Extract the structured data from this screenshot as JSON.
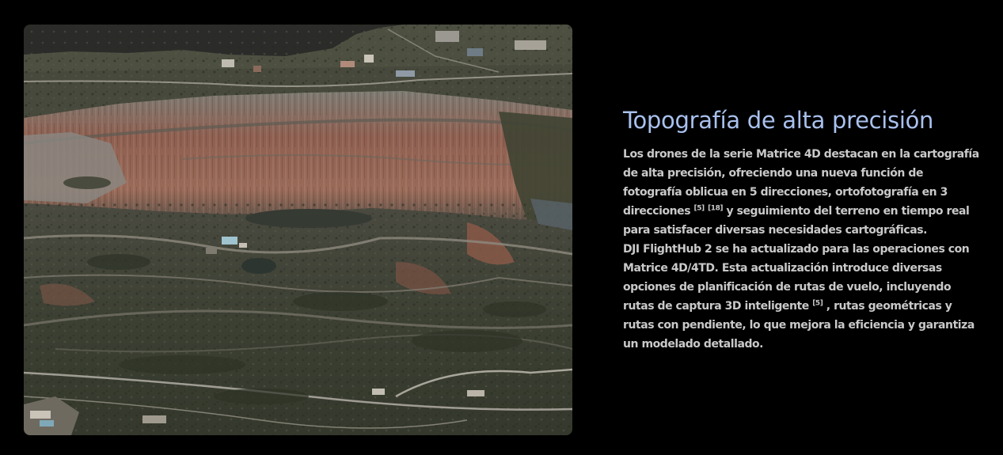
{
  "media": {
    "alt": "",
    "colors": {
      "sky": "#2b2b29",
      "vegetation": "#3d4232",
      "rock_red": "#8a5b4c",
      "rock_grey": "#6c6a66",
      "water": "#353a33",
      "road": "#b3aea6"
    }
  },
  "content": {
    "title": "Topografía de alta precisión",
    "paragraph1": {
      "before_refs": "Los drones de la serie Matrice 4D destacan en la cartografía de alta precisión, ofreciendo una nueva función de fotografía oblicua en 5 direcciones, ortofotografía en 3 direcciones",
      "ref_a": "[5]",
      "ref_b": "[18]",
      "after_refs": "y seguimiento del terreno en tiempo real para satisfacer diversas necesidades cartográficas."
    },
    "paragraph2": {
      "before_ref": "DJI FlightHub 2 se ha actualizado para las operaciones con Matrice 4D/4TD. Esta actualización introduce diversas opciones de planificación de rutas de vuelo, incluyendo rutas de captura 3D inteligente",
      "ref": "[5]",
      "after_ref": ", rutas geométricas y rutas con pendiente, lo que mejora la eficiencia y garantiza un modelado detallado."
    }
  }
}
